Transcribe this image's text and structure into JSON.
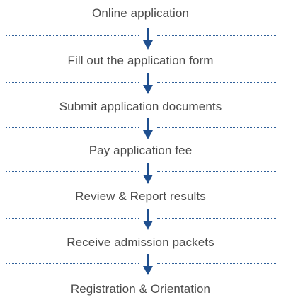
{
  "flowchart": {
    "steps": [
      {
        "label": "Online application"
      },
      {
        "label": "Fill out the application form"
      },
      {
        "label": "Submit application documents"
      },
      {
        "label": "Pay application fee"
      },
      {
        "label": "Review & Report results"
      },
      {
        "label": "Receive admission packets"
      },
      {
        "label": "Registration & Orientation"
      }
    ],
    "colors": {
      "text": "#4a4a4a",
      "arrow": "#1f4f8f",
      "divider": "#2f5f99"
    }
  }
}
